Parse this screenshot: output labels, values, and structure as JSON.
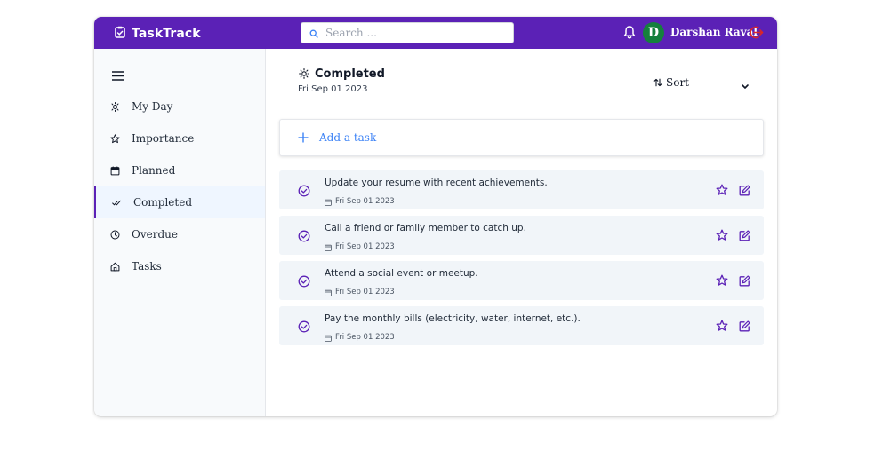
{
  "header": {
    "brand": "TaskTrack",
    "search_placeholder": "Search ...",
    "user_initial": "D",
    "user_name": "Darshan Raval"
  },
  "sidebar": {
    "items": [
      {
        "label": "My Day",
        "icon": "sun-icon"
      },
      {
        "label": "Importance",
        "icon": "star-icon"
      },
      {
        "label": "Planned",
        "icon": "calendar-icon"
      },
      {
        "label": "Completed",
        "icon": "double-check-icon",
        "active": true
      },
      {
        "label": "Overdue",
        "icon": "clock-icon"
      },
      {
        "label": "Tasks",
        "icon": "home-icon"
      }
    ]
  },
  "main": {
    "title": "Completed",
    "date": "Fri Sep 01 2023",
    "sort_label": "Sort",
    "add_task_label": "Add a task",
    "tasks": [
      {
        "title": "Update your resume with recent achievements.",
        "date": "Fri Sep 01 2023"
      },
      {
        "title": "Call a friend or family member to catch up.",
        "date": "Fri Sep 01 2023"
      },
      {
        "title": "Attend a social event or meetup.",
        "date": "Fri Sep 01 2023"
      },
      {
        "title": "Pay the monthly bills (electricity, water, internet, etc.).",
        "date": "Fri Sep 01 2023"
      }
    ]
  },
  "colors": {
    "brand": "#5b21b6",
    "avatar": "#15803d",
    "accent_blue": "#3b82f6",
    "logout": "#dc2626",
    "task_bg": "#f1f5f9"
  }
}
